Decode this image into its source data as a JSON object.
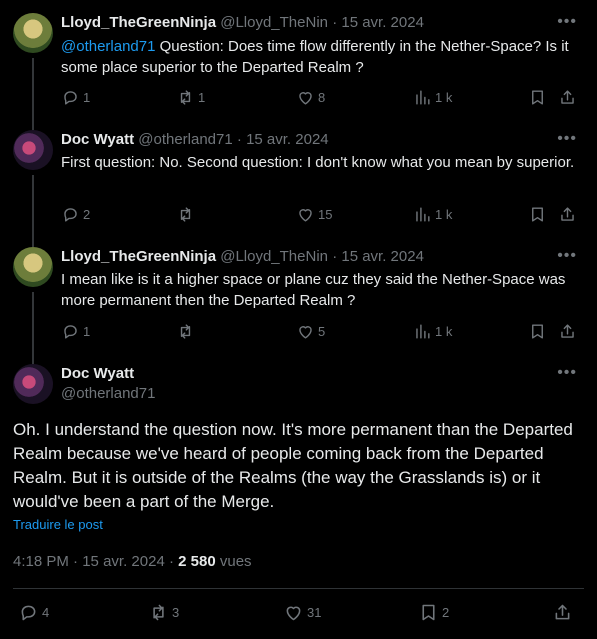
{
  "tweets": [
    {
      "name": "Lloyd_TheGreenNinja",
      "handle": "@Lloyd_TheNin",
      "date": "15 avr. 2024",
      "mention": "@otherland71",
      "text": " Question: Does time flow differently in the Nether-Space? Is it some place superior to the Departed Realm ?",
      "replies": "1",
      "retweets": "1",
      "likes": "8",
      "views": "1 k"
    },
    {
      "name": "Doc Wyatt",
      "handle": "@otherland71",
      "date": "15 avr. 2024",
      "text": "First question: No. Second question: I don't know what you mean by superior.",
      "replies": "2",
      "retweets": "",
      "likes": "15",
      "views": "1 k"
    },
    {
      "name": "Lloyd_TheGreenNinja",
      "handle": "@Lloyd_TheNin",
      "date": "15 avr. 2024",
      "text": "I mean like is it a higher space or plane cuz they said the Nether-Space was more permanent then the Departed Realm ?",
      "replies": "1",
      "retweets": "",
      "likes": "5",
      "views": "1 k"
    }
  ],
  "main": {
    "name": "Doc Wyatt",
    "handle": "@otherland71",
    "text": "Oh. I understand the question now. It's more permanent than the Departed Realm because we've heard of people coming back from the Departed Realm. But it is outside of the Realms (the way the Grasslands is) or it would've been a part of the Merge.",
    "translate": "Traduire le post",
    "time": "4:18 PM",
    "date": "15 avr. 2024",
    "views_count": "2 580",
    "views_label": "vues",
    "replies": "4",
    "retweets": "3",
    "likes": "31",
    "bookmarks": "2"
  },
  "sep": "·",
  "more_glyph": "•••",
  "colors": {
    "background": "#000000",
    "text": "#e7e9ea",
    "muted": "#71767b",
    "link": "#1d9bf0",
    "line": "#333639"
  }
}
